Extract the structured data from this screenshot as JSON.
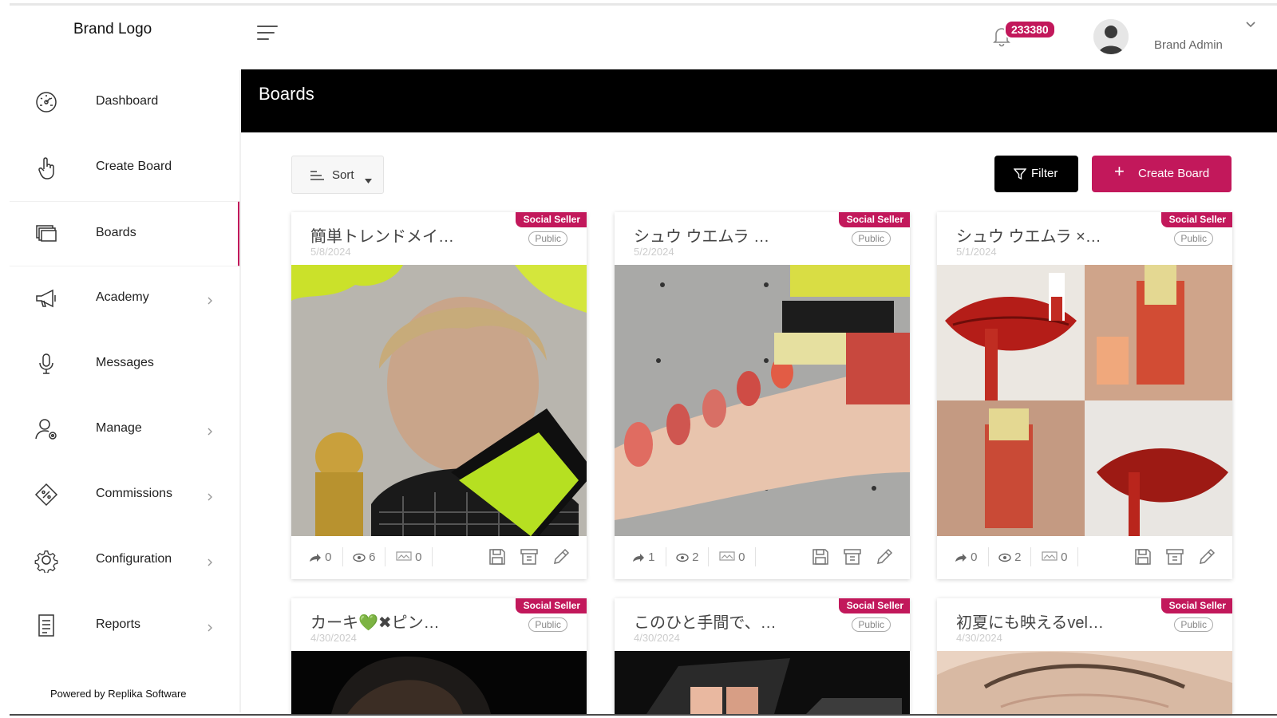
{
  "brand": {
    "logo_text": "Brand Logo"
  },
  "header": {
    "notification_count": "233380",
    "user_name": "Brand Admin"
  },
  "sidebar": {
    "items": [
      {
        "label": "Dashboard",
        "icon": "dashboard-gauge-icon",
        "has_submenu": false,
        "active": false
      },
      {
        "label": "Create Board",
        "icon": "hand-pointer-icon",
        "has_submenu": false,
        "active": false
      },
      {
        "label": "Boards",
        "icon": "boards-stack-icon",
        "has_submenu": false,
        "active": true
      },
      {
        "label": "Academy",
        "icon": "megaphone-icon",
        "has_submenu": true,
        "active": false
      },
      {
        "label": "Messages",
        "icon": "microphone-icon",
        "has_submenu": false,
        "active": false
      },
      {
        "label": "Manage",
        "icon": "user-gear-icon",
        "has_submenu": true,
        "active": false
      },
      {
        "label": "Commissions",
        "icon": "percent-tag-icon",
        "has_submenu": true,
        "active": false
      },
      {
        "label": "Configuration",
        "icon": "gear-icon",
        "has_submenu": true,
        "active": false
      },
      {
        "label": "Reports",
        "icon": "report-document-icon",
        "has_submenu": true,
        "active": false
      }
    ],
    "footer": "Powered by Replika Software"
  },
  "page": {
    "title": "Boards"
  },
  "toolbar": {
    "sort_label": "Sort",
    "filter_label": "Filter",
    "create_label": "Create Board"
  },
  "colors": {
    "accent": "#c2185b",
    "header_bg": "#000000",
    "filter_bg": "#000000"
  },
  "boards": [
    {
      "badge": "Social Seller",
      "title": "簡単トレンドメイ…",
      "date": "5/8/2024",
      "visibility": "Public",
      "shares": "0",
      "views": "6",
      "products": "0"
    },
    {
      "badge": "Social Seller",
      "title": "シュウ ウエムラ …",
      "date": "5/2/2024",
      "visibility": "Public",
      "shares": "1",
      "views": "2",
      "products": "0"
    },
    {
      "badge": "Social Seller",
      "title": "シュウ ウエムラ ×…",
      "date": "5/1/2024",
      "visibility": "Public",
      "shares": "0",
      "views": "2",
      "products": "0"
    },
    {
      "badge": "Social Seller",
      "title": "カーキ💚✖ピン…",
      "date": "4/30/2024",
      "visibility": "Public"
    },
    {
      "badge": "Social Seller",
      "title": "このひと手間で、…",
      "date": "4/30/2024",
      "visibility": "Public"
    },
    {
      "badge": "Social Seller",
      "title": "初夏にも映えるvel…",
      "date": "4/30/2024",
      "visibility": "Public"
    }
  ]
}
